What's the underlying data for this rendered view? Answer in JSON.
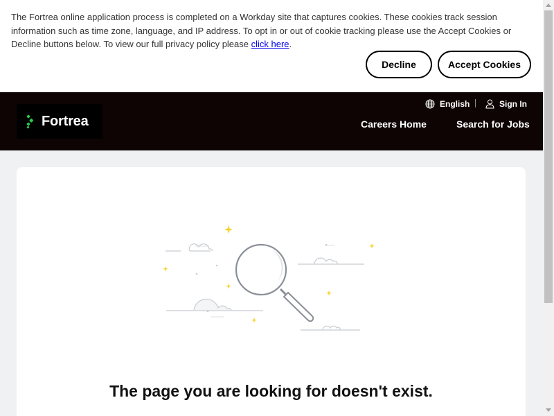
{
  "cookie_banner": {
    "text": "The Fortrea online application process is completed on a Workday site that captures cookies. These cookies track session information such as time zone, language, and IP address. To opt in or out of cookie tracking please use the Accept Cookies or Decline buttons below. To view our full privacy policy please ",
    "link_label": "click here",
    "text_end": ".",
    "decline_label": "Decline",
    "accept_label": "Accept Cookies"
  },
  "header": {
    "logo_text": "Fortrea",
    "language_label": "English",
    "signin_label": "Sign In",
    "nav": {
      "careers_home": "Careers Home",
      "search_jobs": "Search for Jobs"
    }
  },
  "main": {
    "error_title": "The page you are looking for doesn't exist."
  },
  "icons": {
    "language": "globe-icon",
    "signin": "user-icon",
    "illustration": "magnifying-glass-illustration"
  },
  "colors": {
    "header_bg": "#0f0404",
    "page_bg": "#f0f1f2",
    "logo_accent": "#2ec84a",
    "sparkle": "#f5d540"
  }
}
